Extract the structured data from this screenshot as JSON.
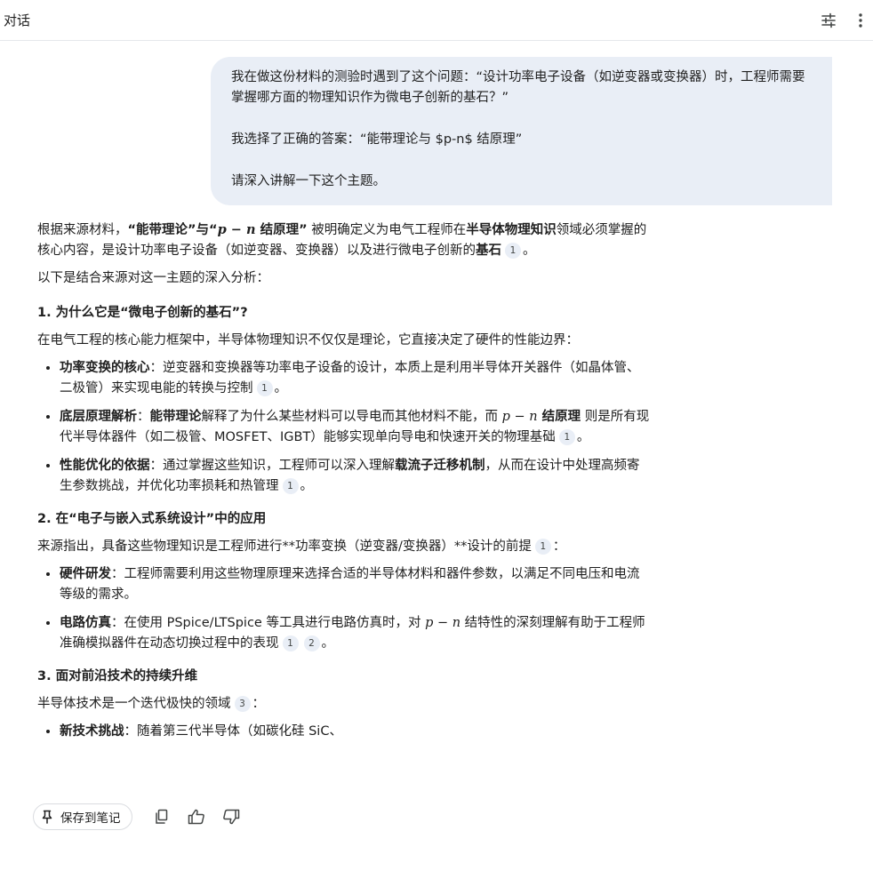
{
  "header": {
    "title": "对话"
  },
  "user_message": {
    "line1": "我在做这份材料的测验时遇到了这个问题：“设计功率电子设备（如逆变器或变换器）时，工程师需要掌握哪方面的物理知识作为微电子创新的基石？”",
    "line2": "我选择了正确的答案：“能带理论与 $p-n$ 结原理”",
    "line3": "请深入讲解一下这个主题。"
  },
  "response": {
    "p1_a": "根据来源材料，",
    "p1_b": "“能带理论”与“",
    "p1_m": "p − n",
    "p1_c": " 结原理”",
    "p1_d": " 被明确定义为电气工程师在",
    "p1_e": "半导体物理知识",
    "p1_f": "领域必须掌握的核心内容，是设计功率电子设备（如逆变器、变换器）以及进行微电子创新的",
    "p1_g": "基石",
    "p1_h": "。",
    "p2": "以下是结合来源对这一主题的深入分析：",
    "s1": {
      "heading": "1. 为什么它是“微电子创新的基石”?",
      "intro": "在电气工程的核心能力框架中，半导体物理知识不仅仅是理论，它直接决定了硬件的性能边界：",
      "b1_label": "功率变换的核心",
      "b1_text": "：逆变器和变换器等功率电子设备的设计，本质上是利用半导体开关器件（如晶体管、二极管）来实现电能的转换与控制",
      "b1_end": "。",
      "b2_label": "底层原理解析",
      "b2_a": "：",
      "b2_b": "能带理论",
      "b2_c": "解释了为什么某些材料可以导电而其他材料不能，而 ",
      "b2_m": "p − n",
      "b2_d": " 结原理",
      "b2_e": " 则是所有现代半导体器件（如二极管、MOSFET、IGBT）能够实现单向导电和快速开关的物理基础",
      "b2_end": "。",
      "b3_label": "性能优化的依据",
      "b3_a": "：通过掌握这些知识，工程师可以深入理解",
      "b3_b": "载流子迁移机制",
      "b3_c": "，从而在设计中处理高频寄生参数挑战，并优化功率损耗和热管理",
      "b3_end": "。"
    },
    "s2": {
      "heading": "2. 在“电子与嵌入式系统设计”中的应用",
      "intro": "来源指出，具备这些物理知识是工程师进行**功率变换（逆变器/变换器）**设计的前提",
      "intro_end": "：",
      "b1_label": "硬件研发",
      "b1_text": "：工程师需要利用这些物理原理来选择合适的半导体材料和器件参数，以满足不同电压和电流等级的需求。",
      "b2_label": "电路仿真",
      "b2_a": "：在使用 PSpice/LTSpice 等工具进行电路仿真时，对 ",
      "b2_m": "p − n",
      "b2_b": " 结特性的深刻理解有助于工程师准确模拟器件在动态切换过程中的表现",
      "b2_end": "。"
    },
    "s3": {
      "heading": "3. 面对前沿技术的持续升维",
      "intro": "半导体技术是一个迭代极快的领域",
      "intro_end": "：",
      "b1_label": "新技术挑战",
      "b1_text": "：随着第三代半导体（如碳化硅 SiC、"
    },
    "citations": {
      "c1": "1",
      "c2": "2",
      "c3": "3"
    }
  },
  "actions": {
    "save_label": "保存到笔记"
  },
  "icons": {
    "tune": "tune-icon",
    "more": "more-vert-icon",
    "pin": "pin-icon",
    "copy": "copy-icon",
    "thumb_up": "thumb-up-icon",
    "thumb_down": "thumb-down-icon"
  }
}
